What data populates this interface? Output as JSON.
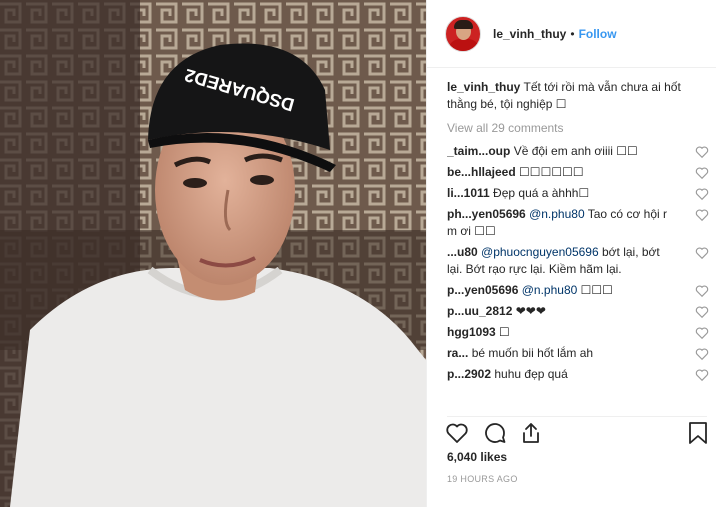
{
  "post": {
    "username": "le_vinh_thuy",
    "separator": "•",
    "follow_label": "Follow",
    "caption_user": "le_vinh_thuy",
    "caption_text": "Tết tới rồi mà vẫn chưa ai hốt thằng bé, tội nghiệp ☐",
    "view_all": "View all 29 comments",
    "likes": "6,040 likes",
    "timestamp": "19 HOURS AGO",
    "cap_text": "DSQUARED2"
  },
  "comments": [
    {
      "user": "_taim...oup",
      "text": "Về đội em anh ơiiii ☐☐"
    },
    {
      "user": "be...hllajeed",
      "text": "☐☐☐☐☐☐"
    },
    {
      "user": "li...1011",
      "text": "Đẹp quá a àhhh☐"
    },
    {
      "user": "ph...yen05696",
      "mention": "@n.phu80",
      "text": "Tao có cơ hội r m ơi ☐☐"
    },
    {
      "user": "...u80",
      "mention": "@phuocnguyen05696",
      "text": "bớt lại, bớt lại. Bớt rạo rực lại. Kiềm hãm lại."
    },
    {
      "user": "p...yen05696",
      "mention": "@n.phu80",
      "text": "☐☐☐"
    },
    {
      "user": "p...uu_2812",
      "text": "❤❤❤"
    },
    {
      "user": "hgg1093",
      "text": "☐"
    },
    {
      "user": "ra...",
      "text": "bé muốn bii hốt lắm ah"
    },
    {
      "user": "p...2902",
      "text": "huhu đẹp quá"
    }
  ],
  "icons": {
    "heart": "heart-icon",
    "comment": "comment-icon",
    "share": "share-icon",
    "bookmark": "bookmark-icon"
  }
}
